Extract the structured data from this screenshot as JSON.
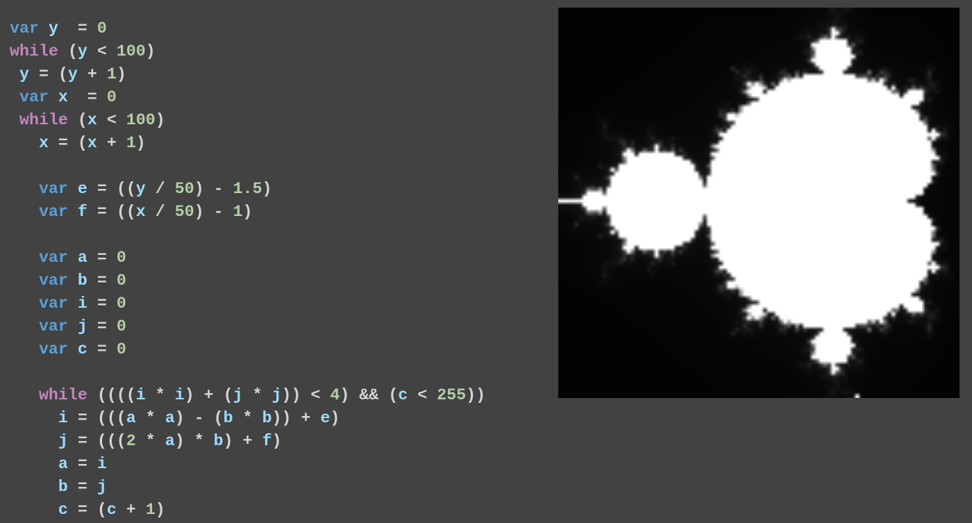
{
  "colors": {
    "background": "#424242",
    "keyword_decl": "#5a9fd8",
    "keyword_control": "#c586c0",
    "identifier": "#9cdcfe",
    "number": "#b5cea8",
    "punctuation": "#d4d4d4"
  },
  "editor": {
    "lines": [
      [
        {
          "t": "kw-var",
          "v": "var"
        },
        {
          "t": "ws",
          "v": " "
        },
        {
          "t": "ident",
          "v": "y"
        },
        {
          "t": "ws",
          "v": "  "
        },
        {
          "t": "punc",
          "v": "="
        },
        {
          "t": "ws",
          "v": " "
        },
        {
          "t": "num",
          "v": "0"
        }
      ],
      [
        {
          "t": "kw-ctl",
          "v": "while"
        },
        {
          "t": "ws",
          "v": " "
        },
        {
          "t": "punc",
          "v": "("
        },
        {
          "t": "ident",
          "v": "y"
        },
        {
          "t": "ws",
          "v": " "
        },
        {
          "t": "punc",
          "v": "<"
        },
        {
          "t": "ws",
          "v": " "
        },
        {
          "t": "num",
          "v": "100"
        },
        {
          "t": "punc",
          "v": ")"
        }
      ],
      [
        {
          "t": "ws",
          "v": " "
        },
        {
          "t": "ident",
          "v": "y"
        },
        {
          "t": "ws",
          "v": " "
        },
        {
          "t": "punc",
          "v": "="
        },
        {
          "t": "ws",
          "v": " "
        },
        {
          "t": "punc",
          "v": "("
        },
        {
          "t": "ident",
          "v": "y"
        },
        {
          "t": "ws",
          "v": " "
        },
        {
          "t": "punc",
          "v": "+"
        },
        {
          "t": "ws",
          "v": " "
        },
        {
          "t": "num",
          "v": "1"
        },
        {
          "t": "punc",
          "v": ")"
        }
      ],
      [
        {
          "t": "ws",
          "v": " "
        },
        {
          "t": "kw-var",
          "v": "var"
        },
        {
          "t": "ws",
          "v": " "
        },
        {
          "t": "ident",
          "v": "x"
        },
        {
          "t": "ws",
          "v": "  "
        },
        {
          "t": "punc",
          "v": "="
        },
        {
          "t": "ws",
          "v": " "
        },
        {
          "t": "num",
          "v": "0"
        }
      ],
      [
        {
          "t": "ws",
          "v": " "
        },
        {
          "t": "kw-ctl",
          "v": "while"
        },
        {
          "t": "ws",
          "v": " "
        },
        {
          "t": "punc",
          "v": "("
        },
        {
          "t": "ident",
          "v": "x"
        },
        {
          "t": "ws",
          "v": " "
        },
        {
          "t": "punc",
          "v": "<"
        },
        {
          "t": "ws",
          "v": " "
        },
        {
          "t": "num",
          "v": "100"
        },
        {
          "t": "punc",
          "v": ")"
        }
      ],
      [
        {
          "t": "ws",
          "v": "   "
        },
        {
          "t": "ident",
          "v": "x"
        },
        {
          "t": "ws",
          "v": " "
        },
        {
          "t": "punc",
          "v": "="
        },
        {
          "t": "ws",
          "v": " "
        },
        {
          "t": "punc",
          "v": "("
        },
        {
          "t": "ident",
          "v": "x"
        },
        {
          "t": "ws",
          "v": " "
        },
        {
          "t": "punc",
          "v": "+"
        },
        {
          "t": "ws",
          "v": " "
        },
        {
          "t": "num",
          "v": "1"
        },
        {
          "t": "punc",
          "v": ")"
        }
      ],
      [],
      [
        {
          "t": "ws",
          "v": "   "
        },
        {
          "t": "kw-var",
          "v": "var"
        },
        {
          "t": "ws",
          "v": " "
        },
        {
          "t": "ident",
          "v": "e"
        },
        {
          "t": "ws",
          "v": " "
        },
        {
          "t": "punc",
          "v": "="
        },
        {
          "t": "ws",
          "v": " "
        },
        {
          "t": "punc",
          "v": "(("
        },
        {
          "t": "ident",
          "v": "y"
        },
        {
          "t": "ws",
          "v": " "
        },
        {
          "t": "punc",
          "v": "/"
        },
        {
          "t": "ws",
          "v": " "
        },
        {
          "t": "num",
          "v": "50"
        },
        {
          "t": "punc",
          "v": ")"
        },
        {
          "t": "ws",
          "v": " "
        },
        {
          "t": "punc",
          "v": "-"
        },
        {
          "t": "ws",
          "v": " "
        },
        {
          "t": "num",
          "v": "1.5"
        },
        {
          "t": "punc",
          "v": ")"
        }
      ],
      [
        {
          "t": "ws",
          "v": "   "
        },
        {
          "t": "kw-var",
          "v": "var"
        },
        {
          "t": "ws",
          "v": " "
        },
        {
          "t": "ident",
          "v": "f"
        },
        {
          "t": "ws",
          "v": " "
        },
        {
          "t": "punc",
          "v": "="
        },
        {
          "t": "ws",
          "v": " "
        },
        {
          "t": "punc",
          "v": "(("
        },
        {
          "t": "ident",
          "v": "x"
        },
        {
          "t": "ws",
          "v": " "
        },
        {
          "t": "punc",
          "v": "/"
        },
        {
          "t": "ws",
          "v": " "
        },
        {
          "t": "num",
          "v": "50"
        },
        {
          "t": "punc",
          "v": ")"
        },
        {
          "t": "ws",
          "v": " "
        },
        {
          "t": "punc",
          "v": "-"
        },
        {
          "t": "ws",
          "v": " "
        },
        {
          "t": "num",
          "v": "1"
        },
        {
          "t": "punc",
          "v": ")"
        }
      ],
      [],
      [
        {
          "t": "ws",
          "v": "   "
        },
        {
          "t": "kw-var",
          "v": "var"
        },
        {
          "t": "ws",
          "v": " "
        },
        {
          "t": "ident",
          "v": "a"
        },
        {
          "t": "ws",
          "v": " "
        },
        {
          "t": "punc",
          "v": "="
        },
        {
          "t": "ws",
          "v": " "
        },
        {
          "t": "num",
          "v": "0"
        }
      ],
      [
        {
          "t": "ws",
          "v": "   "
        },
        {
          "t": "kw-var",
          "v": "var"
        },
        {
          "t": "ws",
          "v": " "
        },
        {
          "t": "ident",
          "v": "b"
        },
        {
          "t": "ws",
          "v": " "
        },
        {
          "t": "punc",
          "v": "="
        },
        {
          "t": "ws",
          "v": " "
        },
        {
          "t": "num",
          "v": "0"
        }
      ],
      [
        {
          "t": "ws",
          "v": "   "
        },
        {
          "t": "kw-var",
          "v": "var"
        },
        {
          "t": "ws",
          "v": " "
        },
        {
          "t": "ident",
          "v": "i"
        },
        {
          "t": "ws",
          "v": " "
        },
        {
          "t": "punc",
          "v": "="
        },
        {
          "t": "ws",
          "v": " "
        },
        {
          "t": "num",
          "v": "0"
        }
      ],
      [
        {
          "t": "ws",
          "v": "   "
        },
        {
          "t": "kw-var",
          "v": "var"
        },
        {
          "t": "ws",
          "v": " "
        },
        {
          "t": "ident",
          "v": "j"
        },
        {
          "t": "ws",
          "v": " "
        },
        {
          "t": "punc",
          "v": "="
        },
        {
          "t": "ws",
          "v": " "
        },
        {
          "t": "num",
          "v": "0"
        }
      ],
      [
        {
          "t": "ws",
          "v": "   "
        },
        {
          "t": "kw-var",
          "v": "var"
        },
        {
          "t": "ws",
          "v": " "
        },
        {
          "t": "ident",
          "v": "c"
        },
        {
          "t": "ws",
          "v": " "
        },
        {
          "t": "punc",
          "v": "="
        },
        {
          "t": "ws",
          "v": " "
        },
        {
          "t": "num",
          "v": "0"
        }
      ],
      [],
      [
        {
          "t": "ws",
          "v": "   "
        },
        {
          "t": "kw-ctl",
          "v": "while"
        },
        {
          "t": "ws",
          "v": " "
        },
        {
          "t": "punc",
          "v": "(((("
        },
        {
          "t": "ident",
          "v": "i"
        },
        {
          "t": "ws",
          "v": " "
        },
        {
          "t": "punc",
          "v": "*"
        },
        {
          "t": "ws",
          "v": " "
        },
        {
          "t": "ident",
          "v": "i"
        },
        {
          "t": "punc",
          "v": ")"
        },
        {
          "t": "ws",
          "v": " "
        },
        {
          "t": "punc",
          "v": "+"
        },
        {
          "t": "ws",
          "v": " "
        },
        {
          "t": "punc",
          "v": "("
        },
        {
          "t": "ident",
          "v": "j"
        },
        {
          "t": "ws",
          "v": " "
        },
        {
          "t": "punc",
          "v": "*"
        },
        {
          "t": "ws",
          "v": " "
        },
        {
          "t": "ident",
          "v": "j"
        },
        {
          "t": "punc",
          "v": "))"
        },
        {
          "t": "ws",
          "v": " "
        },
        {
          "t": "punc",
          "v": "<"
        },
        {
          "t": "ws",
          "v": " "
        },
        {
          "t": "num",
          "v": "4"
        },
        {
          "t": "punc",
          "v": ")"
        },
        {
          "t": "ws",
          "v": " "
        },
        {
          "t": "punc",
          "v": "&&"
        },
        {
          "t": "ws",
          "v": " "
        },
        {
          "t": "punc",
          "v": "("
        },
        {
          "t": "ident",
          "v": "c"
        },
        {
          "t": "ws",
          "v": " "
        },
        {
          "t": "punc",
          "v": "<"
        },
        {
          "t": "ws",
          "v": " "
        },
        {
          "t": "num",
          "v": "255"
        },
        {
          "t": "punc",
          "v": "))"
        }
      ],
      [
        {
          "t": "ws",
          "v": "     "
        },
        {
          "t": "ident",
          "v": "i"
        },
        {
          "t": "ws",
          "v": " "
        },
        {
          "t": "punc",
          "v": "="
        },
        {
          "t": "ws",
          "v": " "
        },
        {
          "t": "punc",
          "v": "((("
        },
        {
          "t": "ident",
          "v": "a"
        },
        {
          "t": "ws",
          "v": " "
        },
        {
          "t": "punc",
          "v": "*"
        },
        {
          "t": "ws",
          "v": " "
        },
        {
          "t": "ident",
          "v": "a"
        },
        {
          "t": "punc",
          "v": ")"
        },
        {
          "t": "ws",
          "v": " "
        },
        {
          "t": "punc",
          "v": "-"
        },
        {
          "t": "ws",
          "v": " "
        },
        {
          "t": "punc",
          "v": "("
        },
        {
          "t": "ident",
          "v": "b"
        },
        {
          "t": "ws",
          "v": " "
        },
        {
          "t": "punc",
          "v": "*"
        },
        {
          "t": "ws",
          "v": " "
        },
        {
          "t": "ident",
          "v": "b"
        },
        {
          "t": "punc",
          "v": "))"
        },
        {
          "t": "ws",
          "v": " "
        },
        {
          "t": "punc",
          "v": "+"
        },
        {
          "t": "ws",
          "v": " "
        },
        {
          "t": "ident",
          "v": "e"
        },
        {
          "t": "punc",
          "v": ")"
        }
      ],
      [
        {
          "t": "ws",
          "v": "     "
        },
        {
          "t": "ident",
          "v": "j"
        },
        {
          "t": "ws",
          "v": " "
        },
        {
          "t": "punc",
          "v": "="
        },
        {
          "t": "ws",
          "v": " "
        },
        {
          "t": "punc",
          "v": "((("
        },
        {
          "t": "num",
          "v": "2"
        },
        {
          "t": "ws",
          "v": " "
        },
        {
          "t": "punc",
          "v": "*"
        },
        {
          "t": "ws",
          "v": " "
        },
        {
          "t": "ident",
          "v": "a"
        },
        {
          "t": "punc",
          "v": ")"
        },
        {
          "t": "ws",
          "v": " "
        },
        {
          "t": "punc",
          "v": "*"
        },
        {
          "t": "ws",
          "v": " "
        },
        {
          "t": "ident",
          "v": "b"
        },
        {
          "t": "punc",
          "v": ")"
        },
        {
          "t": "ws",
          "v": " "
        },
        {
          "t": "punc",
          "v": "+"
        },
        {
          "t": "ws",
          "v": " "
        },
        {
          "t": "ident",
          "v": "f"
        },
        {
          "t": "punc",
          "v": ")"
        }
      ],
      [
        {
          "t": "ws",
          "v": "     "
        },
        {
          "t": "ident",
          "v": "a"
        },
        {
          "t": "ws",
          "v": " "
        },
        {
          "t": "punc",
          "v": "="
        },
        {
          "t": "ws",
          "v": " "
        },
        {
          "t": "ident",
          "v": "i"
        }
      ],
      [
        {
          "t": "ws",
          "v": "     "
        },
        {
          "t": "ident",
          "v": "b"
        },
        {
          "t": "ws",
          "v": " "
        },
        {
          "t": "punc",
          "v": "="
        },
        {
          "t": "ws",
          "v": " "
        },
        {
          "t": "ident",
          "v": "j"
        }
      ],
      [
        {
          "t": "ws",
          "v": "     "
        },
        {
          "t": "ident",
          "v": "c"
        },
        {
          "t": "ws",
          "v": " "
        },
        {
          "t": "punc",
          "v": "="
        },
        {
          "t": "ws",
          "v": " "
        },
        {
          "t": "punc",
          "v": "("
        },
        {
          "t": "ident",
          "v": "c"
        },
        {
          "t": "ws",
          "v": " "
        },
        {
          "t": "punc",
          "v": "+"
        },
        {
          "t": "ws",
          "v": " "
        },
        {
          "t": "num",
          "v": "1"
        },
        {
          "t": "punc",
          "v": ")"
        }
      ]
    ]
  },
  "output": {
    "kind": "mandelbrot-grayscale-render",
    "grid_cols": 100,
    "grid_rows": 100,
    "real_range": [
      -1.5,
      0.5
    ],
    "imag_range": [
      -1.0,
      1.0
    ],
    "max_iterations": 255,
    "escape_radius_squared": 4
  }
}
